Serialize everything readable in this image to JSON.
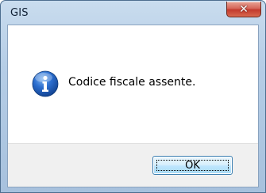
{
  "window": {
    "title": "GIS"
  },
  "titlebar": {
    "close_icon": "close-icon"
  },
  "dialog": {
    "icon": "information-icon",
    "message": "Codice fiscale assente."
  },
  "buttons": {
    "ok_label": "OK"
  },
  "colors": {
    "titlebar": "#b5cde6",
    "close_button": "#c33a2d",
    "info_icon": "#1e63c4",
    "footer": "#f0f0f0"
  }
}
